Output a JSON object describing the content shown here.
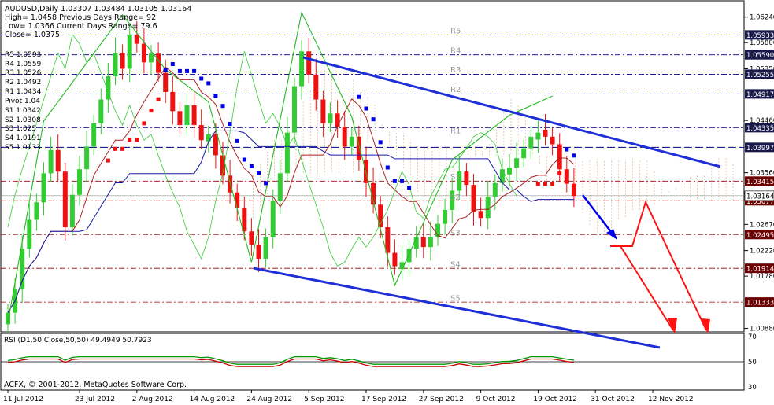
{
  "header": {
    "symbol_line": "AUDUSD,Daily  1.03307 1.03484 1.03105 1.03164",
    "lines": [
      "High= 1.0458    Previous Days Range= 92",
      "Low= 1.0366    Current Days Range= 79.6",
      "Close= 1.0375"
    ]
  },
  "pivot_table": [
    "R5 1.0593",
    "R4 1.0559",
    "R3 1.0526",
    "R2 1.0492",
    "R1 1.0434",
    "Pivot 1.04",
    "S1 1.0342",
    "S2 1.0308",
    "S3 1.025",
    "S4 1.0191",
    "S5 1.0133"
  ],
  "copyright": "ACFX, © 2001-2012, MetaQuotes Software Corp.",
  "rsi": {
    "label": "RSI (D1,50,Close,50,50) 49.4949 50.7923",
    "axis_labels": [
      "70",
      "50",
      "30"
    ]
  },
  "colors": {
    "bull": "#33cc33",
    "bear": "#ee1111",
    "blue": "#0000ee",
    "trend": "#1f2fd8",
    "forecast": "#ff1111",
    "zigzag": "#22bb22",
    "cloud": "#cc8844",
    "dark_red": "#990000",
    "navy": "#000088",
    "price_tag_bg": "#1a1a4a"
  },
  "chart_data": {
    "type": "candlestick",
    "y_axis_ticks": [
      "1.06240",
      "1.05800",
      "1.05350",
      "1.04460",
      "1.03560",
      "1.02670",
      "1.02220",
      "1.01780",
      "1.00880"
    ],
    "y_axis_tick_values": [
      1.0624,
      1.058,
      1.0535,
      1.0446,
      1.0356,
      1.0267,
      1.0222,
      1.0178,
      1.0088
    ],
    "ylim": [
      1.0082,
      1.0652
    ],
    "x_axis_labels": [
      "11 Jul 2012",
      "23 Jul 2012",
      "2 Aug 2012",
      "14 Aug 2012",
      "24 Aug 2012",
      "5 Sep 2012",
      "17 Sep 2012",
      "27 Sep 2012",
      "9 Oct 2012",
      "19 Oct 2012",
      "31 Oct 2012",
      "12 Nov 2012"
    ],
    "x_axis_label_bar_index": [
      0,
      10,
      18,
      26,
      34,
      42,
      50,
      58,
      66,
      74,
      82,
      90
    ],
    "level_tags": [
      {
        "value": "1.05933",
        "kind": "resistance"
      },
      {
        "value": "1.05590",
        "kind": "resistance"
      },
      {
        "value": "1.05255",
        "kind": "resistance"
      },
      {
        "value": "1.04917",
        "kind": "resistance"
      },
      {
        "value": "1.04335",
        "kind": "resistance"
      },
      {
        "value": "1.03997",
        "kind": "pivot"
      },
      {
        "value": "1.03415",
        "kind": "support"
      },
      {
        "value": "1.03077",
        "kind": "support"
      },
      {
        "value": "1.02495",
        "kind": "support"
      },
      {
        "value": "1.01914",
        "kind": "support"
      },
      {
        "value": "1.01333",
        "kind": "support"
      }
    ],
    "current_price": "1.03164",
    "level_labels": [
      {
        "text": "R5",
        "value": 1.0593
      },
      {
        "text": "R4",
        "value": 1.0559
      },
      {
        "text": "R3",
        "value": 1.0526
      },
      {
        "text": "R2",
        "value": 1.0492
      },
      {
        "text": "R1",
        "value": 1.0421
      },
      {
        "text": "S1",
        "value": 1.0342
      },
      {
        "text": "S2",
        "value": 1.0307
      },
      {
        "text": "S3",
        "value": 1.0245
      },
      {
        "text": "S4",
        "value": 1.0191
      },
      {
        "text": "S5",
        "value": 1.0133
      }
    ],
    "closes": [
      1.0115,
      1.0155,
      1.0225,
      1.0275,
      1.0305,
      1.0355,
      1.0395,
      1.0358,
      1.0262,
      1.0318,
      1.0362,
      1.0401,
      1.0441,
      1.0482,
      1.0522,
      1.0562,
      1.0535,
      1.0594,
      1.0578,
      1.0546,
      1.0561,
      1.0528,
      1.0495,
      1.0462,
      1.0438,
      1.0472,
      1.0438,
      1.0412,
      1.0422,
      1.0386,
      1.0351,
      1.0322,
      1.0296,
      1.0255,
      1.0232,
      1.0208,
      1.0245,
      1.0308,
      1.0355,
      1.0425,
      1.0505,
      1.0565,
      1.0525,
      1.0482,
      1.0441,
      1.0458,
      1.0435,
      1.0401,
      1.0418,
      1.0378,
      1.0338,
      1.0301,
      1.0262,
      1.0218,
      1.0195,
      1.0202,
      1.0225,
      1.0245,
      1.0228,
      1.0245,
      1.0268,
      1.0292,
      1.0325,
      1.0358,
      1.0335,
      1.0288,
      1.0278,
      1.0315,
      1.0338,
      1.0362,
      1.0365,
      1.0381,
      1.0398,
      1.0418,
      1.0425,
      1.0418,
      1.0405,
      1.0362,
      1.0337,
      1.0316
    ],
    "bull_bear": [
      "bull",
      "bull",
      "bull",
      "bull",
      "bull",
      "bull",
      "bull",
      "bear",
      "bear",
      "bull",
      "bull",
      "bull",
      "bull",
      "bull",
      "bull",
      "bull",
      "bear",
      "bull",
      "bear",
      "bear",
      "bull",
      "bear",
      "bear",
      "bear",
      "bear",
      "bull",
      "bear",
      "bear",
      "bull",
      "bear",
      "bear",
      "bear",
      "bear",
      "bear",
      "bear",
      "bear",
      "bull",
      "bull",
      "bull",
      "bull",
      "bull",
      "bull",
      "bear",
      "bear",
      "bear",
      "bull",
      "bear",
      "bear",
      "bull",
      "bear",
      "bear",
      "bear",
      "bear",
      "bear",
      "bear",
      "bull",
      "bull",
      "bull",
      "bear",
      "bull",
      "bull",
      "bull",
      "bull",
      "bull",
      "bear",
      "bear",
      "bear",
      "bull",
      "bull",
      "bull",
      "bull",
      "bull",
      "bull",
      "bull",
      "bull",
      "bear",
      "bear",
      "bear",
      "bear",
      "bear"
    ],
    "overlays": [
      "zigzag",
      "tenkan_sen",
      "kijun_sen",
      "ichimoku_cloud",
      "trend_channel",
      "forecast_arrows"
    ],
    "grid": false
  }
}
